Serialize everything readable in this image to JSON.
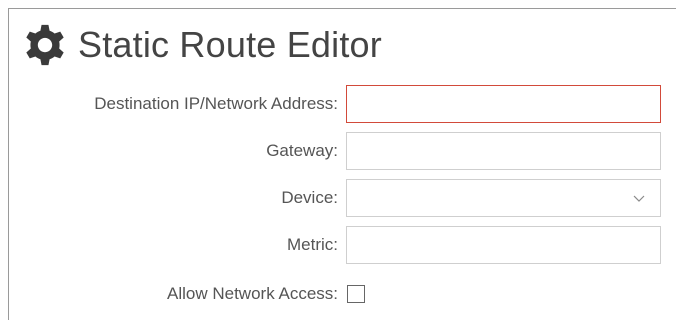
{
  "header": {
    "title": "Static Route Editor",
    "icon": "gear-icon"
  },
  "form": {
    "destination": {
      "label": "Destination IP/Network Address:",
      "value": ""
    },
    "gateway": {
      "label": "Gateway:",
      "value": ""
    },
    "device": {
      "label": "Device:",
      "value": "",
      "icon": "chevron-down-icon"
    },
    "metric": {
      "label": "Metric:",
      "value": ""
    },
    "allow_network_access": {
      "label": "Allow Network Access:",
      "checked": false
    }
  },
  "colors": {
    "error_border": "#d24a3a",
    "field_border": "#cfcfcf",
    "text": "#555555"
  }
}
